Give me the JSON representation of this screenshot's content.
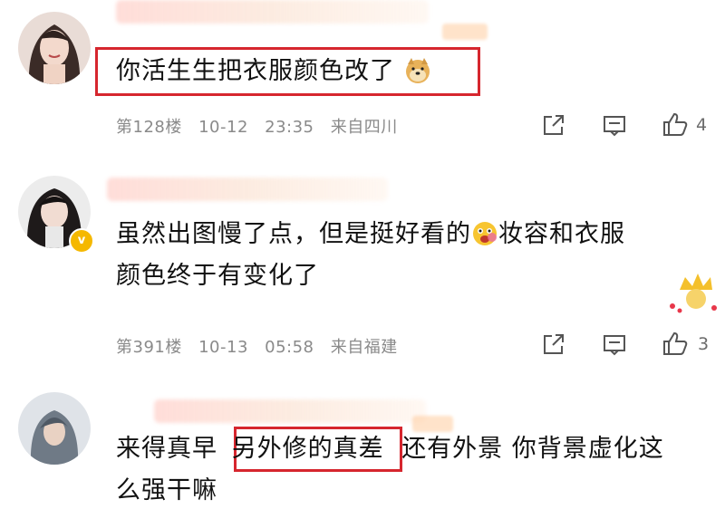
{
  "comments": [
    {
      "text": "你活生生把衣服颜色改了",
      "floor": "第128楼",
      "date": "10-12",
      "time": "23:35",
      "location": "来自四川",
      "likes": "4"
    },
    {
      "text_line1_a": "虽然出图慢了点，但是挺好看的",
      "text_line1_b": "妆容和衣服",
      "text_line2": "颜色终于有变化了",
      "floor": "第391楼",
      "date": "10-13",
      "time": "05:58",
      "location": "来自福建",
      "likes": "3"
    },
    {
      "text_prefix": "来得真早",
      "text_boxed": "另外修的真差",
      "text_suffix": "还有外景 你背景虚化这",
      "text_line2": "么强干嘛"
    }
  ],
  "colors": {
    "highlight_box": "#d6262e",
    "meta_text": "#8a8a8a",
    "verified_badge": "#f5b800"
  },
  "icons": [
    "share-icon",
    "comment-icon",
    "like-icon",
    "doge-emoji",
    "smiley-emoji",
    "crown-sticker"
  ]
}
